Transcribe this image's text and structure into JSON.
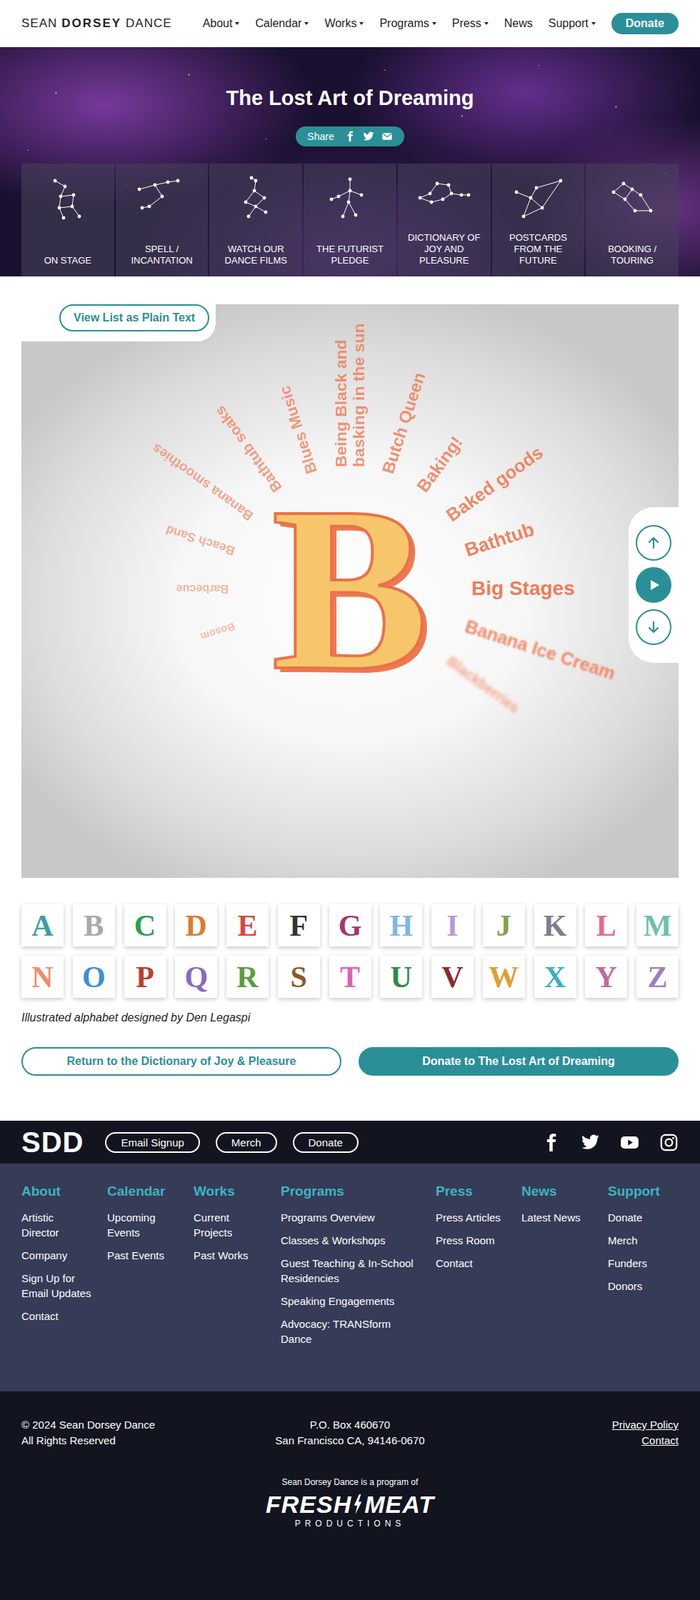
{
  "nav": {
    "logo": [
      {
        "text": "SEAN",
        "bold": false
      },
      {
        "text": "DORSEY",
        "bold": true
      },
      {
        "text": "DANCE",
        "bold": false
      }
    ],
    "items": [
      {
        "label": "About",
        "dropdown": true
      },
      {
        "label": "Calendar",
        "dropdown": true
      },
      {
        "label": "Works",
        "dropdown": true
      },
      {
        "label": "Programs",
        "dropdown": true
      },
      {
        "label": "Press",
        "dropdown": true
      },
      {
        "label": "News",
        "dropdown": false
      },
      {
        "label": "Support",
        "dropdown": true
      }
    ],
    "donate": "Donate"
  },
  "hero": {
    "title": "The Lost Art of Dreaming",
    "share": "Share",
    "tiles": [
      "ON STAGE",
      "SPELL / INCANTATION",
      "WATCH OUR DANCE FILMS",
      "THE FUTURIST PLEDGE",
      "DICTIONARY OF JOY AND PLEASURE",
      "POSTCARDS FROM THE FUTURE",
      "BOOKING / TOURING"
    ]
  },
  "wheel": {
    "plain_text_button": "View List as Plain Text",
    "letter": "B",
    "words": [
      {
        "text": "Blackberries",
        "level": 0.55,
        "selected": false
      },
      {
        "text": "Banana Ice Cream",
        "level": 0.85,
        "selected": false
      },
      {
        "text": "Big Stages",
        "level": 1,
        "selected": true
      },
      {
        "text": "Bathtub",
        "level": 0.92,
        "selected": false
      },
      {
        "text": "Baked goods",
        "level": 0.86,
        "selected": false
      },
      {
        "text": "Baking!",
        "level": 0.8,
        "selected": false
      },
      {
        "text": "Butch Queen",
        "level": 0.76,
        "selected": false
      },
      {
        "text": "Being Black and basking in the sun",
        "level": 0.72,
        "selected": false
      },
      {
        "text": "Blues Music",
        "level": 0.66,
        "selected": false
      },
      {
        "text": "Bathtub soaks",
        "level": 0.6,
        "selected": false
      },
      {
        "text": "Banana smoothies",
        "level": 0.5,
        "selected": false
      },
      {
        "text": "Beach Sand",
        "level": 0.42,
        "selected": false
      },
      {
        "text": "Barbecue",
        "level": 0.34,
        "selected": false
      },
      {
        "text": "Bosom",
        "level": 0.26,
        "selected": false
      }
    ]
  },
  "alphabet": [
    {
      "letter": "A",
      "color": "#3a9fa6"
    },
    {
      "letter": "B",
      "color": "#a9a9a9"
    },
    {
      "letter": "C",
      "color": "#2e9e4f"
    },
    {
      "letter": "D",
      "color": "#e07b2e"
    },
    {
      "letter": "E",
      "color": "#d9463c"
    },
    {
      "letter": "F",
      "color": "#333333"
    },
    {
      "letter": "G",
      "color": "#a8336e"
    },
    {
      "letter": "H",
      "color": "#7fb8e0"
    },
    {
      "letter": "I",
      "color": "#b79ad6"
    },
    {
      "letter": "J",
      "color": "#8aa04a"
    },
    {
      "letter": "K",
      "color": "#7a7f88"
    },
    {
      "letter": "L",
      "color": "#e86a8a"
    },
    {
      "letter": "M",
      "color": "#6cc3a8"
    },
    {
      "letter": "N",
      "color": "#f08a6a"
    },
    {
      "letter": "O",
      "color": "#3a8fd6"
    },
    {
      "letter": "P",
      "color": "#b8402e"
    },
    {
      "letter": "Q",
      "color": "#8a6ac0"
    },
    {
      "letter": "R",
      "color": "#5a9e3a"
    },
    {
      "letter": "S",
      "color": "#8a5a2a"
    },
    {
      "letter": "T",
      "color": "#e060b0"
    },
    {
      "letter": "U",
      "color": "#2e8a4a"
    },
    {
      "letter": "V",
      "color": "#8a2a2a"
    },
    {
      "letter": "W",
      "color": "#e0a030"
    },
    {
      "letter": "X",
      "color": "#3ab0c0"
    },
    {
      "letter": "Y",
      "color": "#c06a9a"
    },
    {
      "letter": "Z",
      "color": "#9a80c0"
    }
  ],
  "caption": "Illustrated alphabet designed by Den Legaspi",
  "actions": {
    "return": "Return to the Dictionary of Joy & Pleasure",
    "donate": "Donate to The Lost Art of Dreaming"
  },
  "footer": {
    "logo": "SDD",
    "pills": [
      "Email Signup",
      "Merch",
      "Donate"
    ],
    "columns": [
      {
        "heading": "About",
        "links": [
          "Artistic Director",
          "Company",
          "Sign Up for Email Updates",
          "Contact"
        ]
      },
      {
        "heading": "Calendar",
        "links": [
          "Upcoming Events",
          "Past Events"
        ]
      },
      {
        "heading": "Works",
        "links": [
          "Current Projects",
          "Past Works"
        ]
      },
      {
        "heading": "Programs",
        "links": [
          "Programs Overview",
          "Classes & Workshops",
          "Guest Teaching & In-School Residencies",
          "Speaking Engagements",
          "Advocacy: TRANSform Dance"
        ]
      },
      {
        "heading": "Press",
        "links": [
          "Press Articles",
          "Press Room",
          "Contact"
        ]
      },
      {
        "heading": "News",
        "links": [
          "Latest News"
        ]
      },
      {
        "heading": "Support",
        "links": [
          "Donate",
          "Merch",
          "Funders",
          "Donors"
        ]
      }
    ],
    "copyright": [
      "© 2024 Sean Dorsey Dance",
      "All Rights Reserved"
    ],
    "address": [
      "P.O. Box 460670",
      "San Francisco CA, 94146-0670"
    ],
    "legal": [
      "Privacy Policy",
      "Contact"
    ],
    "program_of": "Sean Dorsey Dance is a program of",
    "producer": {
      "word1": "FRESH",
      "word2": "MEAT",
      "sub": "PRODUCTIONS"
    }
  }
}
